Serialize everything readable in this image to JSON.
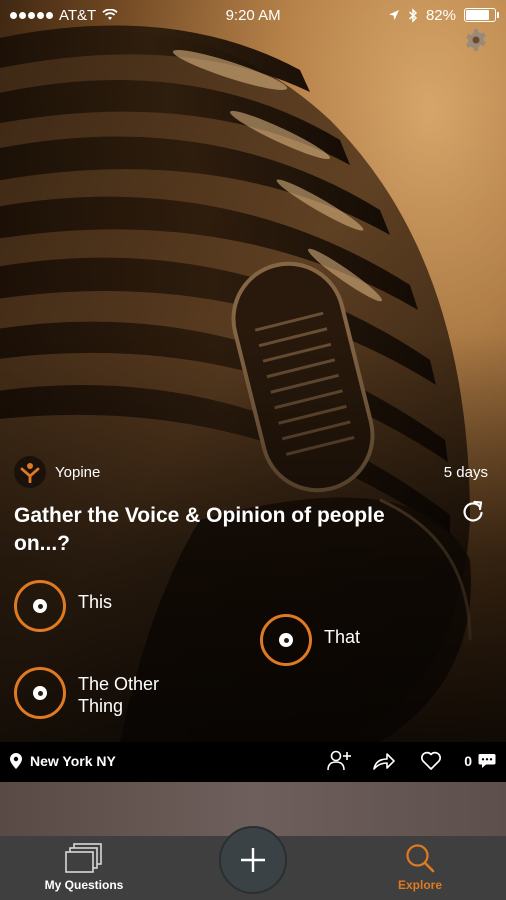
{
  "status_bar": {
    "carrier": "AT&T",
    "time": "9:20 AM",
    "battery_percent": "82%",
    "battery_level": 0.82
  },
  "poll": {
    "author": "Yopine",
    "age": "5 days",
    "question": "Gather the Voice & Opinion of people on...?",
    "options": [
      {
        "label": "This"
      },
      {
        "label": "That"
      },
      {
        "label": "The Other Thing"
      }
    ],
    "location": "New York NY",
    "comment_count": "0"
  },
  "tab_bar": {
    "my_questions_label": "My Questions",
    "explore_label": "Explore"
  },
  "colors": {
    "accent": "#e07a22",
    "tab_bar_bg": "#3f3f3f"
  },
  "icons": [
    "signal-dots-icon",
    "wifi-icon",
    "location-arrow-icon",
    "bluetooth-icon",
    "battery-icon",
    "gear-icon",
    "yopine-logo-icon",
    "refresh-icon",
    "location-pin-icon",
    "add-friend-icon",
    "share-icon",
    "heart-icon",
    "comment-icon",
    "stack-icon",
    "plus-icon",
    "search-icon"
  ]
}
